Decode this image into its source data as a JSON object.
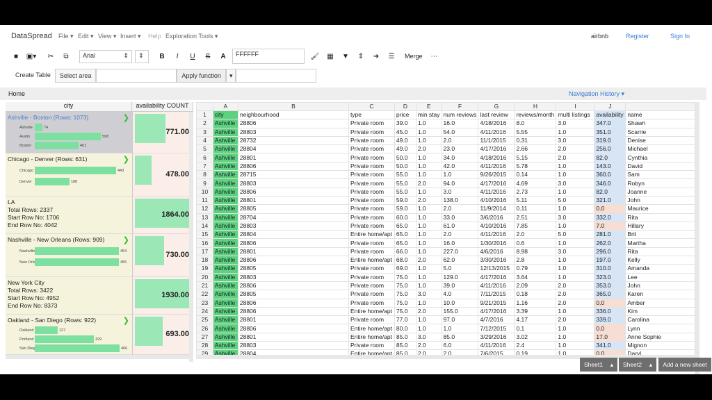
{
  "app": {
    "brand": "DataSpread",
    "user": "airbnb",
    "register": "Register",
    "signin": "Sign In"
  },
  "menu": [
    "File",
    "Edit",
    "View",
    "Insert",
    "Help",
    "Exploration Tools"
  ],
  "toolbar": {
    "font": "Arial",
    "color_value": "FFFFFF",
    "merge": "Merge"
  },
  "row2": {
    "create_table": "Create Table",
    "select_area": "Select area",
    "apply_function": "Apply function"
  },
  "breadcrumb": {
    "home": "Home",
    "nav_history": "Navigation History"
  },
  "left_panel": {
    "col_city": "city",
    "col_agg": "availability COUNT",
    "cards": [
      {
        "title": "Ashville - Boston (Rows: 1073)",
        "bars": [
          {
            "label": "Ashville",
            "value": "74",
            "frac": 0.09
          },
          {
            "label": "Austin",
            "value": "598",
            "frac": 0.78
          },
          {
            "label": "Boston",
            "value": "401",
            "frac": 0.52
          }
        ],
        "agg": "771.00",
        "aggfrac": 0.55
      },
      {
        "title": "Chicago - Denver (Rows: 631)",
        "bars": [
          {
            "label": "Chicago",
            "value": "443",
            "frac": 0.96
          },
          {
            "label": "Denver",
            "value": "188",
            "frac": 0.41
          }
        ],
        "agg": "478.00",
        "aggfrac": 0.3
      },
      {
        "title": "LA",
        "lines": [
          "Total Rows: 2337",
          "Start Row No: 1706",
          "End Row No: 4042"
        ],
        "agg": "1864.00",
        "aggfrac": 0.99
      },
      {
        "title": "Nashville - New Orleans (Rows: 909)",
        "bars": [
          {
            "label": "Nashville",
            "value": "454",
            "frac": 0.99
          },
          {
            "label": "New Orleans",
            "value": "455",
            "frac": 0.99
          }
        ],
        "agg": "730.00",
        "aggfrac": 0.52
      },
      {
        "title": "New York City",
        "lines": [
          "Total Rows: 3422",
          "Start Row No: 4952",
          "End Row No: 8373"
        ],
        "agg": "1930.00",
        "aggfrac": 0.99
      },
      {
        "title": "Oakland - San Diego (Rows: 922)",
        "bars": [
          {
            "label": "Oakland",
            "value": "127",
            "frac": 0.27
          },
          {
            "label": "Portland",
            "value": "329",
            "frac": 0.7
          },
          {
            "label": "San Diego",
            "value": "466",
            "frac": 1.0
          }
        ],
        "agg": "693.00",
        "aggfrac": 0.5
      }
    ]
  },
  "sheet": {
    "letters": [
      "A",
      "B",
      "C",
      "D",
      "E",
      "F",
      "G",
      "H",
      "I",
      "J"
    ],
    "headers": [
      "city",
      "neighbourhood",
      "type",
      "price",
      "min stay",
      "num reviews",
      "last review",
      "reviews/month",
      "multi listings",
      "availability",
      "name"
    ],
    "rows": [
      [
        "2",
        "Ashville",
        "28806",
        "Private room",
        "39.0",
        "1.0",
        "16.0",
        "4/18/2016",
        "8.0",
        "3.0",
        "347.0",
        "Shawn"
      ],
      [
        "3",
        "Ashville",
        "28803",
        "Private room",
        "45.0",
        "1.0",
        "54.0",
        "4/11/2016",
        "5.55",
        "1.0",
        "351.0",
        "Scarrie"
      ],
      [
        "4",
        "Ashville",
        "28732",
        "Private room",
        "49.0",
        "1.0",
        "2.0",
        "11/1/2015",
        "0.31",
        "3.0",
        "319.0",
        "Denise"
      ],
      [
        "5",
        "Ashville",
        "28804",
        "Private room",
        "49.0",
        "2.0",
        "23.0",
        "4/17/2016",
        "2.66",
        "2.0",
        "256.0",
        "Michael"
      ],
      [
        "6",
        "Ashville",
        "28801",
        "Private room",
        "50.0",
        "1.0",
        "34.0",
        "4/18/2016",
        "5.15",
        "2.0",
        "82.0",
        "Cynthia"
      ],
      [
        "7",
        "Ashville",
        "28806",
        "Private room",
        "50.0",
        "1.0",
        "42.0",
        "4/11/2016",
        "5.78",
        "1.0",
        "143.0",
        "David"
      ],
      [
        "8",
        "Ashville",
        "28715",
        "Private room",
        "55.0",
        "1.0",
        "1.0",
        "9/26/2015",
        "0.14",
        "1.0",
        "360.0",
        "Sam"
      ],
      [
        "9",
        "Ashville",
        "28803",
        "Private room",
        "55.0",
        "2.0",
        "94.0",
        "4/17/2016",
        "4.69",
        "3.0",
        "346.0",
        "Robyn"
      ],
      [
        "10",
        "Ashville",
        "28806",
        "Private room",
        "55.0",
        "1.0",
        "3.0",
        "4/11/2016",
        "2.73",
        "1.0",
        "82.0",
        "Joanne"
      ],
      [
        "11",
        "Ashville",
        "28801",
        "Private room",
        "59.0",
        "2.0",
        "138.0",
        "4/10/2016",
        "5.11",
        "5.0",
        "321.0",
        "John"
      ],
      [
        "12",
        "Ashville",
        "28805",
        "Private room",
        "59.0",
        "1.0",
        "2.0",
        "11/9/2014",
        "0.11",
        "1.0",
        "0.0",
        "Maurice"
      ],
      [
        "13",
        "Ashville",
        "28704",
        "Private room",
        "60.0",
        "1.0",
        "33.0",
        "3/6/2016",
        "2.51",
        "3.0",
        "332.0",
        "Rita"
      ],
      [
        "14",
        "Ashville",
        "28803",
        "Private room",
        "65.0",
        "1.0",
        "61.0",
        "4/10/2016",
        "7.85",
        "1.0",
        "7.0",
        "Hillary"
      ],
      [
        "15",
        "Ashville",
        "28804",
        "Entire home/apt",
        "65.0",
        "1.0",
        "2.0",
        "4/11/2016",
        "2.0",
        "5.0",
        "281.0",
        "Brit"
      ],
      [
        "16",
        "Ashville",
        "28806",
        "Private room",
        "65.0",
        "1.0",
        "16.0",
        "1/30/2016",
        "0.6",
        "1.0",
        "262.0",
        "Martha"
      ],
      [
        "17",
        "Ashville",
        "28801",
        "Private room",
        "66.0",
        "1.0",
        "227.0",
        "4/6/2016",
        "8.98",
        "3.0",
        "296.0",
        "Rita"
      ],
      [
        "18",
        "Ashville",
        "28806",
        "Entire home/apt",
        "68.0",
        "2.0",
        "62.0",
        "3/30/2016",
        "2.8",
        "1.0",
        "197.0",
        "Kelly"
      ],
      [
        "19",
        "Ashville",
        "28805",
        "Private room",
        "69.0",
        "1.0",
        "5.0",
        "12/13/2015",
        "0.79",
        "1.0",
        "310.0",
        "Amanda"
      ],
      [
        "20",
        "Ashville",
        "28803",
        "Private room",
        "75.0",
        "1.0",
        "129.0",
        "4/17/2016",
        "3.64",
        "1.0",
        "323.0",
        "Lee"
      ],
      [
        "21",
        "Ashville",
        "28806",
        "Private room",
        "75.0",
        "1.0",
        "39.0",
        "4/11/2016",
        "2.09",
        "2.0",
        "353.0",
        "John"
      ],
      [
        "22",
        "Ashville",
        "28805",
        "Private room",
        "75.0",
        "3.0",
        "4.0",
        "7/11/2015",
        "0.18",
        "2.0",
        "365.0",
        "Karen"
      ],
      [
        "23",
        "Ashville",
        "28806",
        "Private room",
        "75.0",
        "1.0",
        "10.0",
        "9/21/2015",
        "1.16",
        "2.0",
        "0.0",
        "Amber"
      ],
      [
        "24",
        "Ashville",
        "28806",
        "Entire home/apt",
        "75.0",
        "2.0",
        "155.0",
        "4/17/2016",
        "3.39",
        "1.0",
        "336.0",
        "Kim"
      ],
      [
        "25",
        "Ashville",
        "28801",
        "Private room",
        "77.0",
        "1.0",
        "97.0",
        "4/7/2016",
        "4.17",
        "2.0",
        "339.0",
        "Carolina"
      ],
      [
        "26",
        "Ashville",
        "28806",
        "Entire home/apt",
        "80.0",
        "1.0",
        "1.0",
        "7/12/2015",
        "0.1",
        "1.0",
        "0.0",
        "Lynn"
      ],
      [
        "27",
        "Ashville",
        "28801",
        "Entire home/apt",
        "85.0",
        "3.0",
        "85.0",
        "3/29/2016",
        "3.02",
        "1.0",
        "17.0",
        "Anne Sophie"
      ],
      [
        "28",
        "Ashville",
        "28803",
        "Private room",
        "85.0",
        "2.0",
        "6.0",
        "4/11/2016",
        "2.4",
        "1.0",
        "341.0",
        "Mignon"
      ],
      [
        "29",
        "Ashville",
        "28804",
        "Entire home/apt",
        "85.0",
        "2.0",
        "2.0",
        "7/6/2015",
        "0.19",
        "1.0",
        "0.0",
        "Daryl"
      ]
    ]
  },
  "sheets": {
    "tab1": "Sheet1",
    "tab2": "Sheet2",
    "add": "Add a new sheet"
  }
}
